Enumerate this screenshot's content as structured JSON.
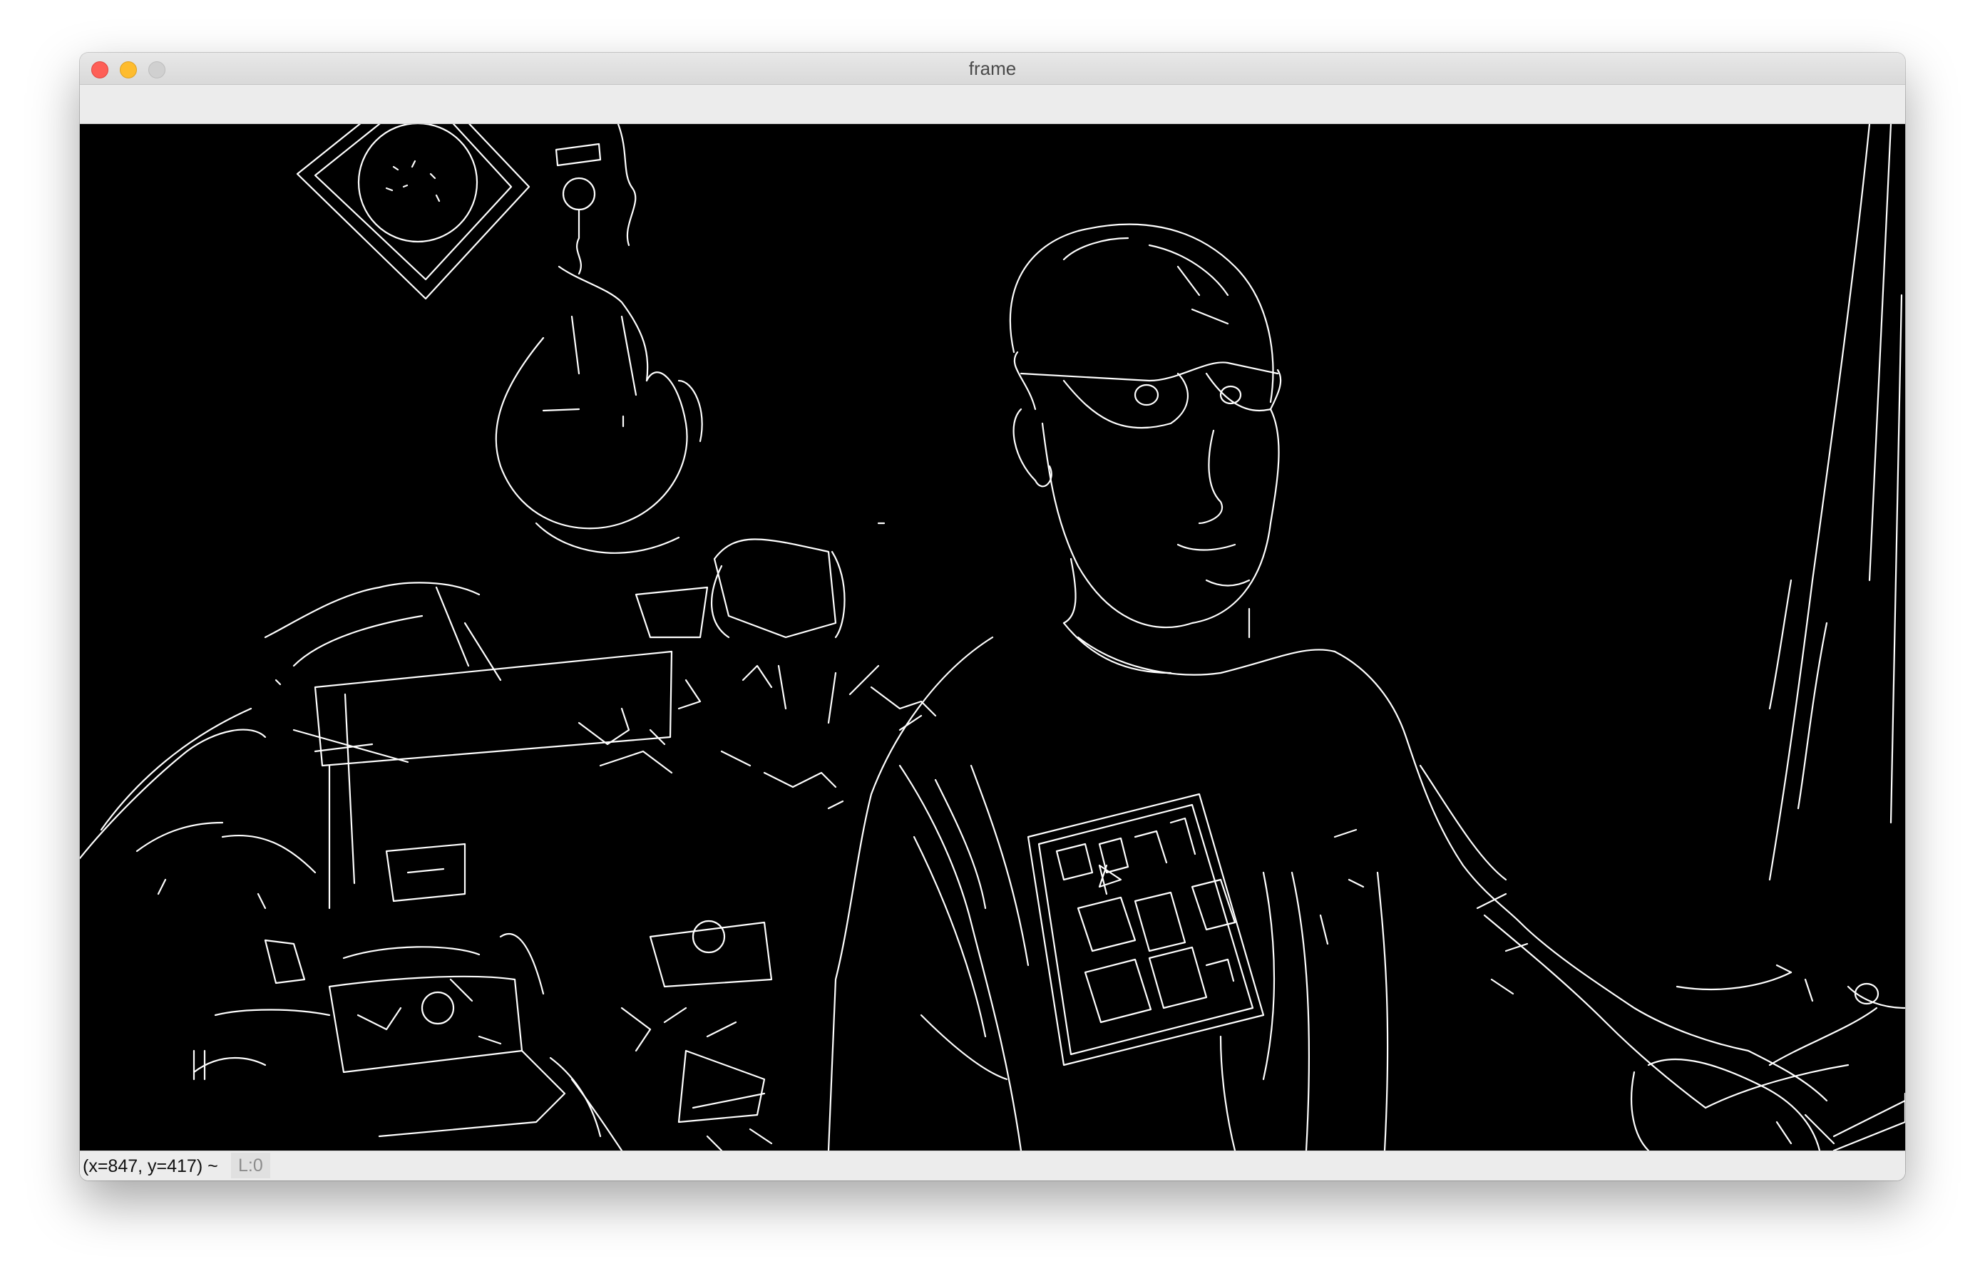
{
  "window": {
    "title": "frame",
    "controls": [
      "close",
      "minimize",
      "zoom"
    ]
  },
  "image": {
    "description_kind": "canny-edge-map",
    "background": "#000000",
    "edge_color": "#ffffff"
  },
  "status": {
    "coords": "(x=847, y=417) ~",
    "level": "L:0"
  }
}
